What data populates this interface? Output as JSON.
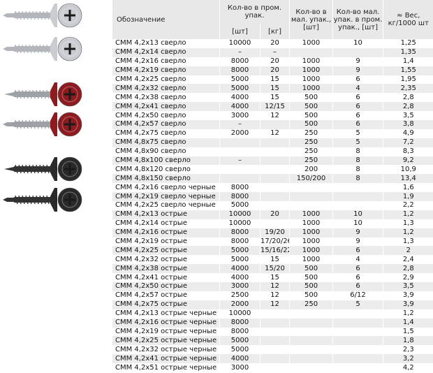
{
  "header": {
    "name": "Обозначение",
    "qty_prom": "Кол-во в пром. упак.",
    "qty_mal": "Кол-во в мал. упак., [шт]",
    "qty_mal_in_prom": "Кол-во мал. упак. в пром. упак., [шт]",
    "weight": "≈ Вес, кг/1000 шт",
    "unit_pcs": "[шт]",
    "unit_kg": "[кг]"
  },
  "images": [
    {
      "name": "screw-drill-zinc",
      "color": "#c9ccd0",
      "tip": "drill"
    },
    {
      "name": "screw-drill-zinc",
      "color": "#c9ccd0",
      "tip": "drill"
    },
    {
      "name": "screw-sharp-red",
      "color": "#8e1b1f",
      "tip": "sharp"
    },
    {
      "name": "screw-drill-red",
      "color": "#8e1b1f",
      "tip": "drill"
    },
    {
      "name": "screw-sharp-black",
      "color": "#2a2a2a",
      "tip": "sharp"
    },
    {
      "name": "screw-drill-black",
      "color": "#2a2a2a",
      "tip": "drill"
    }
  ],
  "rows": [
    {
      "name": "СММ 4,2х13 сверло",
      "pcs": "10000",
      "kg": "20",
      "small": "1000",
      "packs": "10",
      "weight": "1,25"
    },
    {
      "name": "СММ 4,2х14 сверло",
      "pcs": "–",
      "kg": "–",
      "small": "",
      "packs": "",
      "weight": "1,35"
    },
    {
      "name": "СММ 4,2х16 сверло",
      "pcs": "8000",
      "kg": "20",
      "small": "1000",
      "packs": "9",
      "weight": "1,4"
    },
    {
      "name": "СММ 4,2х19 сверло",
      "pcs": "8000",
      "kg": "20",
      "small": "1000",
      "packs": "9",
      "weight": "1,55"
    },
    {
      "name": "СММ 4,2х25 сверло",
      "pcs": "5000",
      "kg": "15",
      "small": "1000",
      "packs": "6",
      "weight": "1,95"
    },
    {
      "name": "СММ 4,2х32 сверло",
      "pcs": "5000",
      "kg": "15",
      "small": "1000",
      "packs": "4",
      "weight": "2,35"
    },
    {
      "name": "СММ 4,2х38 сверло",
      "pcs": "4000",
      "kg": "15",
      "small": "500",
      "packs": "6",
      "weight": "2,8"
    },
    {
      "name": "СММ 4,2х41 сверло",
      "pcs": "4000",
      "kg": "12/15",
      "small": "500",
      "packs": "6",
      "weight": "2,8"
    },
    {
      "name": "СММ 4,2х50 сверло",
      "pcs": "3000",
      "kg": "12",
      "small": "500",
      "packs": "6",
      "weight": "3,5"
    },
    {
      "name": "СММ 4,2х57 сверло",
      "pcs": "–",
      "kg": "",
      "small": "500",
      "packs": "6",
      "weight": "3,8"
    },
    {
      "name": "СММ 4,2х75 сверло",
      "pcs": "2000",
      "kg": "12",
      "small": "250",
      "packs": "5",
      "weight": "4,9"
    },
    {
      "name": "СММ 4,8х75 сверло",
      "pcs": "",
      "kg": "",
      "small": "250",
      "packs": "5",
      "weight": "7,2"
    },
    {
      "name": "СММ 4,8х90 сверло",
      "pcs": "",
      "kg": "",
      "small": "250",
      "packs": "8",
      "weight": "8,3"
    },
    {
      "name": "СММ 4,8х100 сверло",
      "pcs": "–",
      "kg": "",
      "small": "250",
      "packs": "8",
      "weight": "9,2"
    },
    {
      "name": "СММ 4,8х120 сверло",
      "pcs": "",
      "kg": "",
      "small": "200",
      "packs": "8",
      "weight": "10,9"
    },
    {
      "name": "СММ 4,8х150 сверло",
      "pcs": "",
      "kg": "",
      "small": "150/200",
      "packs": "8",
      "weight": "13,4"
    },
    {
      "name": "СММ 4,2х16 сверло черные",
      "pcs": "8000",
      "kg": "",
      "small": "",
      "packs": "",
      "weight": "1,6"
    },
    {
      "name": "СММ 4,2х19 сверло черные",
      "pcs": "8000",
      "kg": "",
      "small": "",
      "packs": "",
      "weight": "1,9"
    },
    {
      "name": "СММ 4,2х25 сверло черные",
      "pcs": "5000",
      "kg": "",
      "small": "",
      "packs": "",
      "weight": "2,2"
    },
    {
      "name": "СММ 4,2х13 острые",
      "pcs": "10000",
      "kg": "20",
      "small": "1000",
      "packs": "10",
      "weight": "1,2"
    },
    {
      "name": "СММ 4,2х14 острые",
      "pcs": "10000",
      "kg": "",
      "small": "1000",
      "packs": "10",
      "weight": "1,3"
    },
    {
      "name": "СММ 4,2х16 острые",
      "pcs": "8000",
      "kg": "19/20",
      "small": "1000",
      "packs": "9",
      "weight": "1,2"
    },
    {
      "name": "СММ 4,2х19 острые",
      "pcs": "8000",
      "kg": "17/20/26",
      "small": "1000",
      "packs": "9",
      "weight": "1,3"
    },
    {
      "name": "СММ 4,2х25 острые",
      "pcs": "5000",
      "kg": "15/16/22",
      "small": "1000",
      "packs": "6",
      "weight": "2"
    },
    {
      "name": "СММ 4,2х32 острые",
      "pcs": "5000",
      "kg": "15",
      "small": "1000",
      "packs": "4",
      "weight": "2,4"
    },
    {
      "name": "СММ 4,2х38 острые",
      "pcs": "4000",
      "kg": "15/20",
      "small": "500",
      "packs": "6",
      "weight": "2,8"
    },
    {
      "name": "СММ 4,2х41 острые",
      "pcs": "4000",
      "kg": "15",
      "small": "500",
      "packs": "6",
      "weight": "2,9"
    },
    {
      "name": "СММ 4,2х50 острые",
      "pcs": "3000",
      "kg": "12",
      "small": "500",
      "packs": "6",
      "weight": "3,5"
    },
    {
      "name": "СММ 4,2х57 острые",
      "pcs": "2500",
      "kg": "12",
      "small": "500",
      "packs": "6/12",
      "weight": "3,9"
    },
    {
      "name": "СММ 4,2х75 острые",
      "pcs": "2000",
      "kg": "12",
      "small": "250",
      "packs": "5",
      "weight": "3,9"
    },
    {
      "name": "СММ 4,2х13 острые черные",
      "pcs": "10000",
      "kg": "",
      "small": "",
      "packs": "",
      "weight": "1,2"
    },
    {
      "name": "СММ 4,2х16 острые черные",
      "pcs": "8000",
      "kg": "",
      "small": "",
      "packs": "",
      "weight": "1,4"
    },
    {
      "name": "СММ 4,2х19 острые черные",
      "pcs": "8000",
      "kg": "",
      "small": "",
      "packs": "",
      "weight": "1,5"
    },
    {
      "name": "СММ 4,2х25 острые черные",
      "pcs": "5000",
      "kg": "",
      "small": "",
      "packs": "",
      "weight": "1,8"
    },
    {
      "name": "СММ 4,2х32 острые черные",
      "pcs": "5000",
      "kg": "",
      "small": "",
      "packs": "",
      "weight": "2,3"
    },
    {
      "name": "СММ 4,2х41 острые черные",
      "pcs": "4000",
      "kg": "",
      "small": "",
      "packs": "",
      "weight": "3,2"
    },
    {
      "name": "СММ 4,2х51 острые черные",
      "pcs": "3000",
      "kg": "",
      "small": "",
      "packs": "",
      "weight": "4,2"
    }
  ]
}
